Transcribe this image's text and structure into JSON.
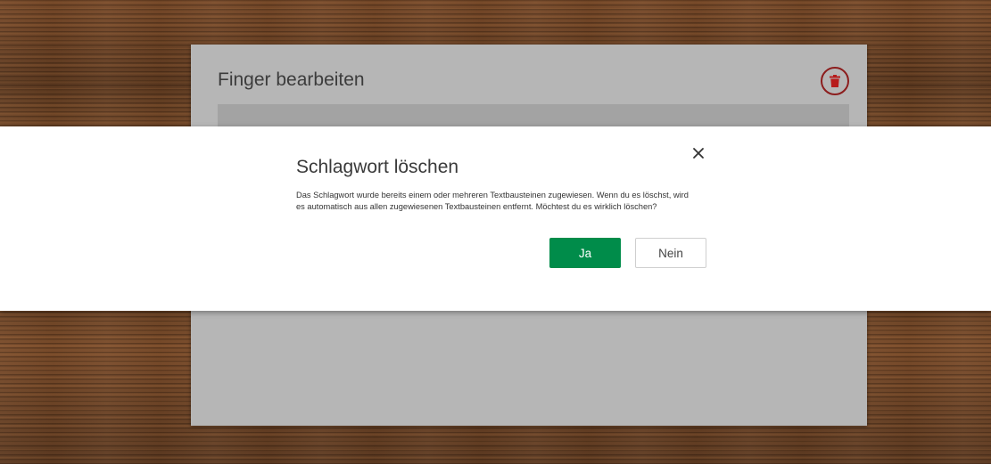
{
  "background": {
    "texture": "wood",
    "color": "#6e4426"
  },
  "panel": {
    "title": "Finger bearbeiten",
    "delete_icon": "trash-icon",
    "delete_color": "#8c1d1d"
  },
  "dialog": {
    "title": "Schlagwort löschen",
    "message_line1": "Das Schlagwort wurde bereits einem oder mehreren Textbausteinen zugewiesen. Wenn du es löschst, wird",
    "message_line2": "es automatisch aus allen zugewiesenen Textbausteinen entfernt. Möchtest du es wirklich löschen?",
    "close_icon": "close-icon",
    "confirm_label": "Ja",
    "confirm_color": "#008c4a",
    "cancel_label": "Nein"
  }
}
